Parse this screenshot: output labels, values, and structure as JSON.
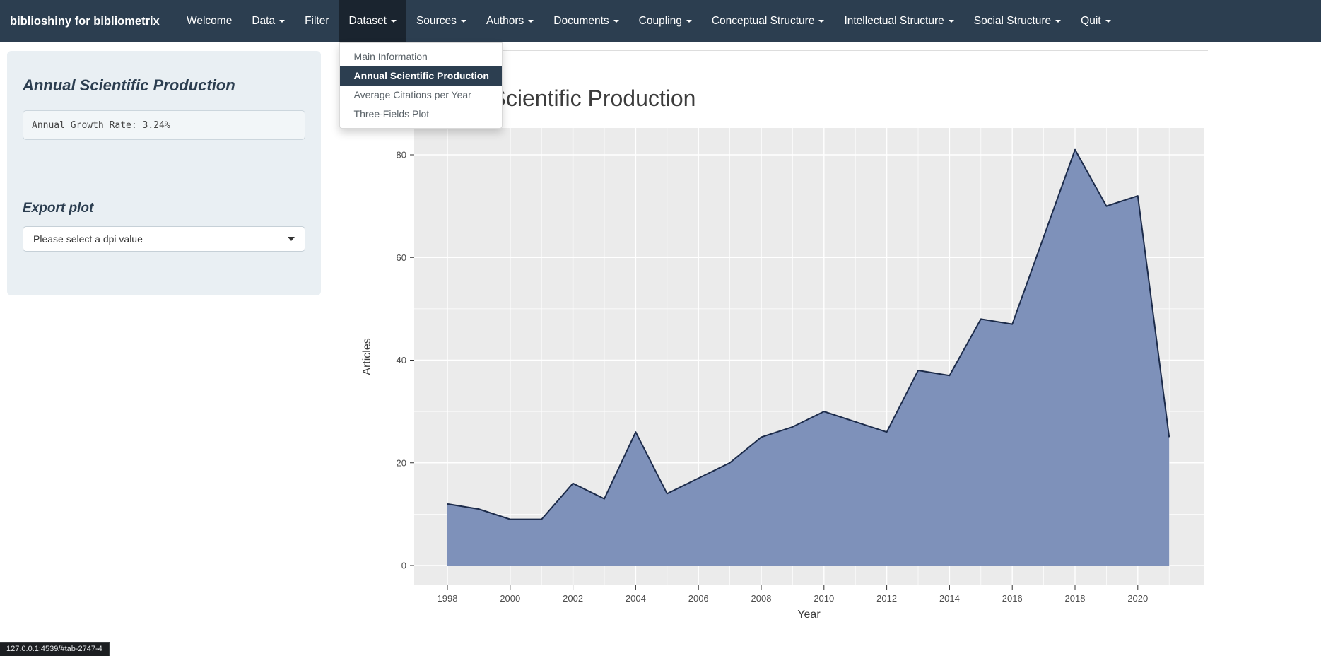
{
  "navbar": {
    "brand": "biblioshiny for bibliometrix",
    "items": [
      {
        "label": "Welcome",
        "caret": false,
        "active": false
      },
      {
        "label": "Data",
        "caret": true,
        "active": false
      },
      {
        "label": "Filter",
        "caret": false,
        "active": false
      },
      {
        "label": "Dataset",
        "caret": true,
        "active": true
      },
      {
        "label": "Sources",
        "caret": true,
        "active": false
      },
      {
        "label": "Authors",
        "caret": true,
        "active": false
      },
      {
        "label": "Documents",
        "caret": true,
        "active": false
      },
      {
        "label": "Coupling",
        "caret": true,
        "active": false
      },
      {
        "label": "Conceptual Structure",
        "caret": true,
        "active": false
      },
      {
        "label": "Intellectual Structure",
        "caret": true,
        "active": false
      },
      {
        "label": "Social Structure",
        "caret": true,
        "active": false
      },
      {
        "label": "Quit",
        "caret": true,
        "active": false
      }
    ]
  },
  "dropdown": {
    "parent": "Dataset",
    "items": [
      {
        "label": "Main Information",
        "active": false
      },
      {
        "label": "Annual Scientific Production",
        "active": true
      },
      {
        "label": "Average Citations per Year",
        "active": false
      },
      {
        "label": "Three-Fields Plot",
        "active": false
      }
    ]
  },
  "sidebar": {
    "title": "Annual Scientific Production",
    "growth_rate_text": "Annual Growth Rate: 3.24%",
    "export_label": "Export plot",
    "dpi_select": {
      "value": "Please select a dpi value"
    }
  },
  "statusbar": {
    "text": "127.0.0.1:4539/#tab-2747-4"
  },
  "chart_data": {
    "type": "area",
    "title": "Annual Scientific Production",
    "xlabel": "Year",
    "ylabel": "Articles",
    "x": [
      1998,
      1999,
      2000,
      2001,
      2002,
      2003,
      2004,
      2005,
      2006,
      2007,
      2008,
      2009,
      2010,
      2011,
      2012,
      2013,
      2014,
      2015,
      2016,
      2017,
      2018,
      2019,
      2020,
      2021
    ],
    "values": [
      12,
      11,
      9,
      9,
      16,
      13,
      26,
      14,
      17,
      20,
      25,
      27,
      30,
      28,
      26,
      38,
      37,
      48,
      47,
      64,
      81,
      70,
      72,
      25
    ],
    "x_ticks": [
      1998,
      2000,
      2002,
      2004,
      2006,
      2008,
      2010,
      2012,
      2014,
      2016,
      2018,
      2020
    ],
    "y_ticks": [
      0,
      20,
      40,
      60,
      80
    ],
    "y_minor": [
      10,
      30,
      50,
      70
    ],
    "xlim": [
      1996.9,
      2022.1
    ],
    "ylim": [
      -4,
      85.2
    ],
    "grid": true,
    "legend": "none",
    "colors": {
      "panel": "#ebebeb",
      "grid": "#ffffff",
      "fill": "#7e91ba",
      "line": "#1c2b4a"
    }
  }
}
